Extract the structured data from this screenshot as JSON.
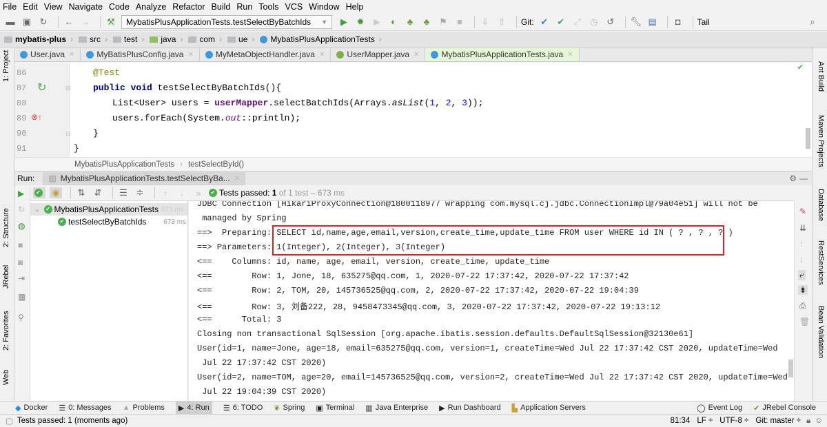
{
  "menu": [
    "File",
    "Edit",
    "View",
    "Navigate",
    "Code",
    "Analyze",
    "Refactor",
    "Build",
    "Run",
    "Tools",
    "VCS",
    "Window",
    "Help"
  ],
  "toolbar": {
    "run_config": "MybatisPlusApplicationTests.testSelectByBatchIds",
    "git_label": "Git:",
    "tail_label": "Tail"
  },
  "nav": [
    "mybatis-plus",
    "src",
    "test",
    "java",
    "com",
    "ue",
    "MybatisPlusApplicationTests"
  ],
  "tabs": [
    "User.java",
    "MyBatisPlusConfig.java",
    "MyMetaObjectHandler.java",
    "UserMapper.java",
    "MybatisPlusApplicationTests.java"
  ],
  "editor": {
    "line_numbers": [
      "86",
      "87",
      "88",
      "89",
      "90",
      "91"
    ],
    "lines": {
      "l86": "@Test",
      "l87a": "public void ",
      "l87b": "testSelectByBatchIds(){",
      "l88a": "List<User> users = ",
      "l88b": "userMapper",
      ".l88c": "",
      "l88c": ".selectBatchIds(Arrays.",
      "l88d": "asList",
      "l88e": "(",
      "l88f": "1",
      "l88g": ", ",
      "l88h": "2",
      "l88i": ", ",
      "l88j": "3",
      "l88k": "));",
      "l89a": "users.forEach(System.",
      "l89b": "out",
      "l89c": "::println);",
      "l90": "}",
      "l91": "}"
    },
    "breadcrumb": [
      "MybatisPlusApplicationTests",
      "testSelectById()"
    ]
  },
  "left_strip": [
    "1: Project",
    "2: Structure",
    "JRebel",
    "2: Favorites",
    "Web"
  ],
  "right_strip": [
    "Ant Build",
    "Maven Projects",
    "Database",
    "RestServices",
    "Bean Validation"
  ],
  "run": {
    "label": "Run:",
    "tab": "MybatisPlusApplicationTests.testSelectByBa...",
    "status_prefix": "Tests passed: ",
    "status_count": "1",
    "status_suffix": " of 1 test – 673 ms",
    "tree": [
      {
        "name": "MybatisPlusApplicationTests",
        "time": "673 ms"
      },
      {
        "name": "testSelectByBatchIds",
        "time": "673 ms"
      }
    ],
    "console": [
      "JDBC Connection [HikariProxyConnection@1800118977 wrapping com.mysql.cj.jdbc.ConnectionImpl@79a04e51] will not be",
      " managed by Spring",
      "==>  Preparing: SELECT id,name,age,email,version,create_time,update_time FROM user WHERE id IN ( ? , ? , ? )",
      "==> Parameters: 1(Integer), 2(Integer), 3(Integer)",
      "<==    Columns: id, name, age, email, version, create_time, update_time",
      "<==        Row: 1, Jone, 18, 635275@qq.com, 1, 2020-07-22 17:37:42, 2020-07-22 17:37:42",
      "<==        Row: 2, TOM, 20, 145736525@qq.com, 2, 2020-07-22 17:37:42, 2020-07-22 19:04:39",
      "<==        Row: 3, 刘备222, 28, 9458473345@qq.com, 3, 2020-07-22 17:37:42, 2020-07-22 19:13:12",
      "<==      Total: 3",
      "Closing non transactional SqlSession [org.apache.ibatis.session.defaults.DefaultSqlSession@32130e61]",
      "User(id=1, name=Jone, age=18, email=635275@qq.com, version=1, createTime=Wed Jul 22 17:37:42 CST 2020, updateTime=Wed",
      " Jul 22 17:37:42 CST 2020)",
      "User(id=2, name=TOM, age=20, email=145736525@qq.com, version=2, createTime=Wed Jul 22 17:37:42 CST 2020, updateTime=Wed",
      " Jul 22 19:04:39 CST 2020)"
    ]
  },
  "bottom_tabs": [
    "Docker",
    "0: Messages",
    "Problems",
    "4: Run",
    "6: TODO",
    "Spring",
    "Terminal",
    "Java Enterprise",
    "Run Dashboard",
    "Application Servers"
  ],
  "bottom_right_tabs": [
    "Event Log",
    "JRebel Console"
  ],
  "status": {
    "message": "Tests passed: 1 (moments ago)",
    "position": "81:34",
    "line_sep": "LF ÷",
    "encoding": "UTF-8 ÷",
    "git": "Git: master ÷"
  },
  "colors": {
    "accent_green": "#4cae4c",
    "highlight_box": "#dd2222",
    "active_tab": "#e6f6d8"
  }
}
